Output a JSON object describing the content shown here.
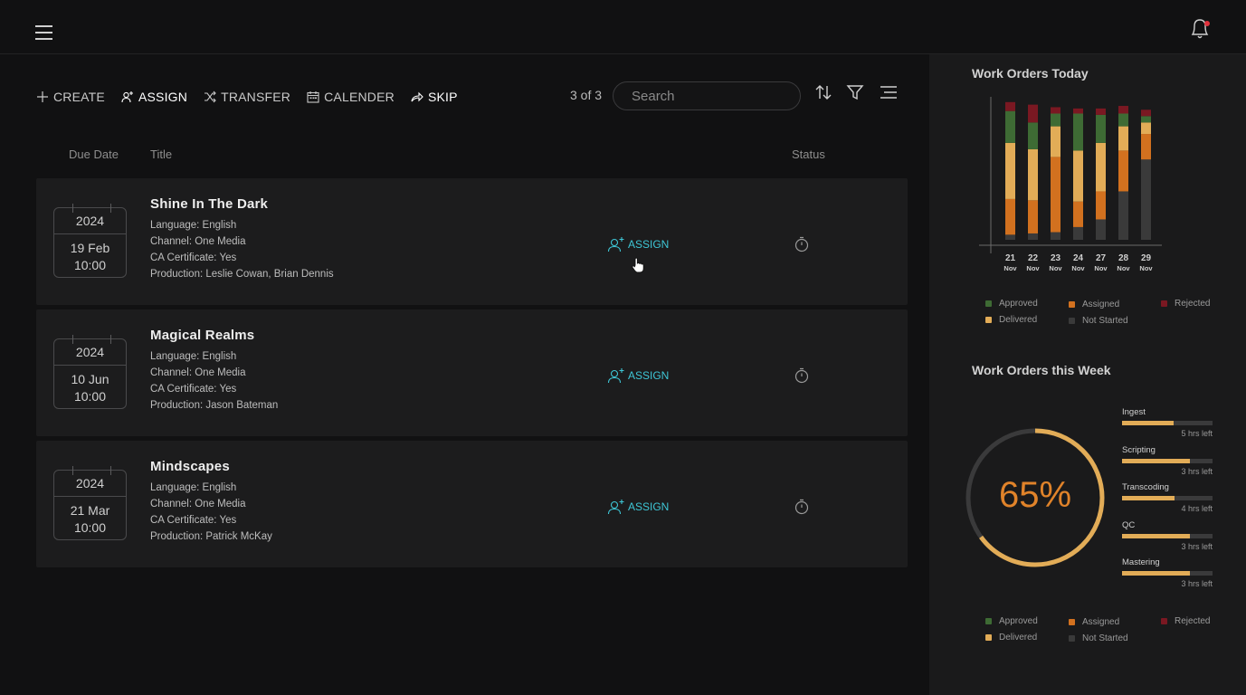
{
  "toolbar": {
    "create": "CREATE",
    "assign": "ASSIGN",
    "transfer": "TRANSFER",
    "calender": "CALENDER",
    "skip": "SKIP"
  },
  "result_count": "3 of 3",
  "search": {
    "placeholder": "Search"
  },
  "columns": {
    "due_date": "Due Date",
    "title": "Title",
    "status": "Status"
  },
  "rows": [
    {
      "year": "2024",
      "date": "19 Feb",
      "time": "10:00",
      "title": "Shine In The Dark",
      "language": "Language: English",
      "channel": "Channel: One Media",
      "certificate": "CA Certificate: Yes",
      "production": "Production: Leslie Cowan, Brian Dennis",
      "action": "ASSIGN"
    },
    {
      "year": "2024",
      "date": "10 Jun",
      "time": "10:00",
      "title": "Magical Realms",
      "language": "Language: English",
      "channel": "Channel: One Media",
      "certificate": "CA Certificate: Yes",
      "production": "Production: Jason Bateman",
      "action": "ASSIGN"
    },
    {
      "year": "2024",
      "date": "21 Mar",
      "time": "10:00",
      "title": "Mindscapes",
      "language": "Language: English",
      "channel": "Channel: One Media",
      "certificate": "CA Certificate: Yes",
      "production": "Production: Patrick McKay",
      "action": "ASSIGN"
    }
  ],
  "panel": {
    "today_title": "Work Orders Today",
    "week_title": "Work Orders this Week",
    "legend": {
      "approved": "Approved",
      "assigned": "Assigned",
      "rejected": "Rejected",
      "delivered": "Delivered",
      "not_started": "Not Started"
    },
    "percent": "65%",
    "percent_value": 0.65,
    "tasks": [
      {
        "name": "Ingest",
        "left": "5 hrs left",
        "progress": 0.57
      },
      {
        "name": "Scripting",
        "left": "3 hrs left",
        "progress": 0.75
      },
      {
        "name": "Transcoding",
        "left": "4 hrs left",
        "progress": 0.58
      },
      {
        "name": "QC",
        "left": "3 hrs left",
        "progress": 0.75
      },
      {
        "name": "Mastering",
        "left": "3 hrs left",
        "progress": 0.75
      }
    ]
  },
  "colors": {
    "approved": "#3e6b34",
    "assigned": "#d2711f",
    "rejected": "#7a1822",
    "delivered": "#e2ac57",
    "not_started": "#3a3a3a",
    "accent": "#3ec6d6",
    "percent": "#e0832a"
  },
  "chart_data": {
    "type": "bar",
    "stacked": true,
    "categories": [
      "21 Nov",
      "22 Nov",
      "23 Nov",
      "24 Nov",
      "27 Nov",
      "28 Nov",
      "29 Nov"
    ],
    "category_days": [
      "21",
      "22",
      "23",
      "24",
      "27",
      "28",
      "29"
    ],
    "category_months": [
      "Nov",
      "Nov",
      "Nov",
      "Nov",
      "Nov",
      "Nov",
      "Nov"
    ],
    "series": [
      {
        "name": "Not Started",
        "color": "#3a3a3a",
        "values": [
          4,
          5,
          6,
          10,
          16,
          38,
          63
        ]
      },
      {
        "name": "Assigned",
        "color": "#d2711f",
        "values": [
          28,
          26,
          59,
          20,
          22,
          32,
          20
        ]
      },
      {
        "name": "Delivered",
        "color": "#e2ac57",
        "values": [
          44,
          40,
          24,
          40,
          38,
          19,
          9
        ]
      },
      {
        "name": "Approved",
        "color": "#3e6b34",
        "values": [
          25,
          21,
          10,
          29,
          22,
          10,
          5
        ]
      },
      {
        "name": "Rejected",
        "color": "#7a1822",
        "values": [
          7,
          14,
          5,
          4,
          5,
          6,
          5
        ]
      }
    ],
    "ylim": [
      0,
      110
    ],
    "grid": false,
    "legend_position": "bottom"
  }
}
